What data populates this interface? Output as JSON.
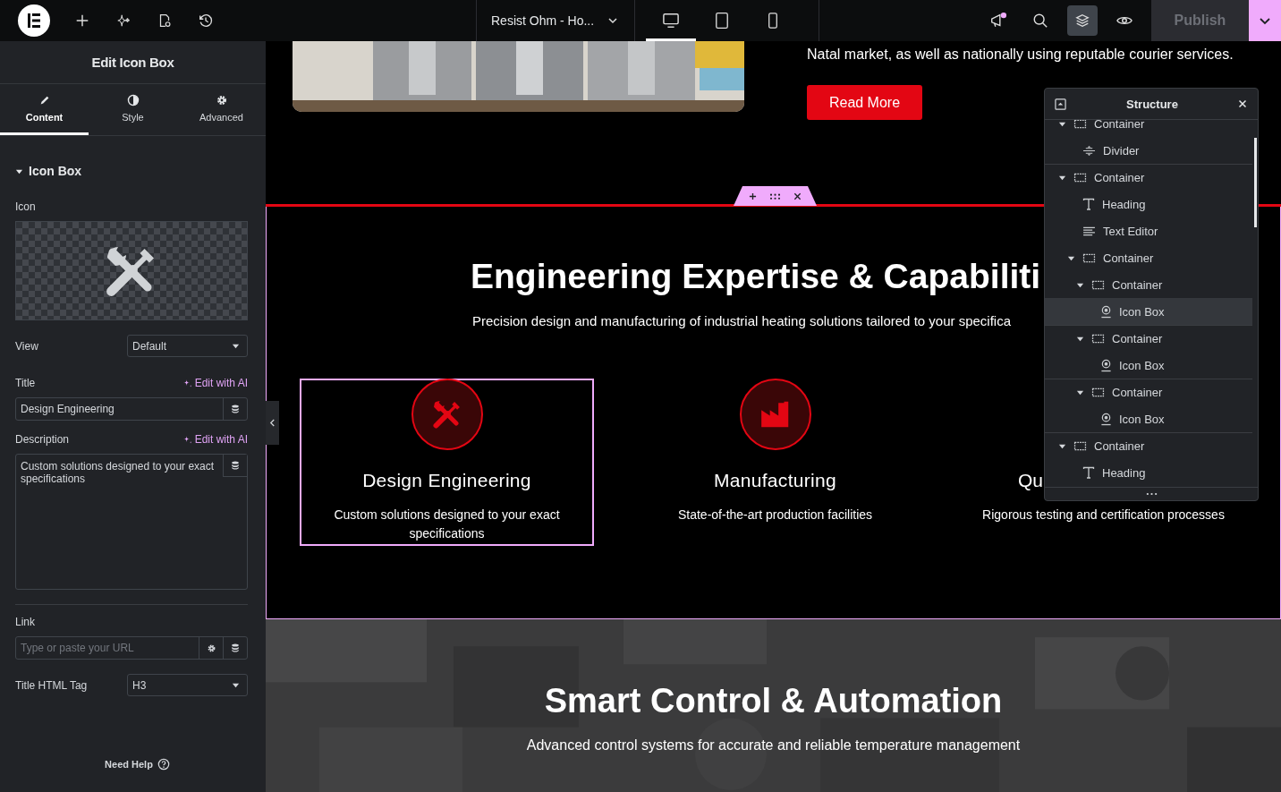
{
  "top_bar": {
    "tools": [
      {
        "kind": "add"
      },
      {
        "kind": "ai"
      },
      {
        "kind": "page-settings"
      },
      {
        "kind": "history"
      }
    ],
    "document_title": "Resist Ohm - Ho...",
    "devices": [
      {
        "kind": "desktop",
        "selected": true
      },
      {
        "kind": "tablet",
        "selected": false
      },
      {
        "kind": "mobile",
        "selected": false
      }
    ],
    "actions": [
      {
        "kind": "announcements",
        "selected": false,
        "unread": true
      },
      {
        "kind": "search",
        "selected": false
      },
      {
        "kind": "structure",
        "selected": true
      },
      {
        "kind": "preview",
        "selected": false
      }
    ],
    "publish": {
      "label": "Publish",
      "disabled": true
    }
  },
  "panel": {
    "title": "Edit Icon Box",
    "tabs": [
      {
        "kind": "content",
        "label": "Content",
        "selected": true
      },
      {
        "kind": "style",
        "label": "Style",
        "selected": false
      },
      {
        "kind": "advanced",
        "label": "Advanced",
        "selected": false
      }
    ],
    "section": {
      "label": "Icon Box",
      "expanded": true
    },
    "icon_label": "Icon",
    "view": {
      "label": "View",
      "value": "Default"
    },
    "title_field": {
      "label": "Title",
      "ai_label": "Edit with AI",
      "value": "Design Engineering"
    },
    "description": {
      "label": "Description",
      "ai_label": "Edit with AI",
      "value": "Custom solutions designed to your exact specifications"
    },
    "link": {
      "label": "Link",
      "placeholder": "Type or paste your URL"
    },
    "title_tag": {
      "label": "Title HTML Tag",
      "value": "H3"
    },
    "help": "Need Help"
  },
  "canvas": {
    "intro_text": "Natal market, as well as nationally using reputable courier services.",
    "read_more": "Read More",
    "heading": "Engineering Expertise & Capabiliti",
    "subtitle": "Precision design and manufacturing of industrial heating solutions tailored to your specifica",
    "features": [
      {
        "kind": "tools",
        "title": "Design Engineering",
        "text": "Custom solutions designed to your exact specifications",
        "selected": true
      },
      {
        "kind": "factory",
        "title": "Manufacturing",
        "text": "State-of-the-art production facilities",
        "selected": false
      },
      {
        "kind": "hidden",
        "title": "Qu",
        "text": "Rigorous testing and certification processes",
        "selected": false
      }
    ],
    "automation": {
      "heading": "Smart Control & Automation",
      "text": "Advanced control systems for accurate and reliable temperature management"
    }
  },
  "structure": {
    "title": "Structure",
    "items": [
      {
        "kind": "container",
        "label": "Container",
        "expanded": true,
        "selected": false,
        "children": [
          {
            "kind": "divider",
            "label": "Divider",
            "selected": false
          }
        ]
      },
      {
        "kind": "container",
        "label": "Container",
        "expanded": true,
        "selected": false,
        "children": [
          {
            "kind": "heading",
            "label": "Heading",
            "selected": false
          },
          {
            "kind": "text-editor",
            "label": "Text Editor",
            "selected": false
          },
          {
            "kind": "container",
            "label": "Container",
            "expanded": true,
            "selected": false,
            "children": [
              {
                "kind": "container",
                "label": "Container",
                "expanded": true,
                "selected": false,
                "children": [
                  {
                    "kind": "icon-box",
                    "label": "Icon Box",
                    "selected": true
                  }
                ]
              },
              {
                "kind": "container",
                "label": "Container",
                "expanded": true,
                "selected": false,
                "children": [
                  {
                    "kind": "icon-box",
                    "label": "Icon Box",
                    "selected": false
                  }
                ]
              },
              {
                "kind": "container",
                "label": "Container",
                "expanded": true,
                "selected": false,
                "children": [
                  {
                    "kind": "icon-box",
                    "label": "Icon Box",
                    "selected": false
                  }
                ]
              }
            ]
          }
        ]
      },
      {
        "kind": "container",
        "label": "Container",
        "expanded": true,
        "selected": false,
        "children": [
          {
            "kind": "heading",
            "label": "Heading",
            "selected": false
          }
        ]
      }
    ]
  }
}
